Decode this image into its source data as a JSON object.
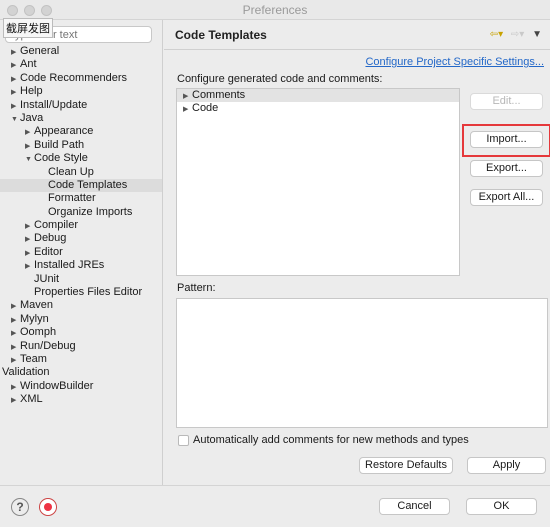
{
  "window": {
    "title": "Preferences",
    "capture_label": "截屏发图"
  },
  "sidebar": {
    "filter_placeholder": "type filter text",
    "items": [
      {
        "label": "General",
        "arrow": "▶"
      },
      {
        "label": "Ant",
        "arrow": "▶"
      },
      {
        "label": "Code Recommenders",
        "arrow": "▶"
      },
      {
        "label": "Help",
        "arrow": "▶"
      },
      {
        "label": "Install/Update",
        "arrow": "▶"
      },
      {
        "label": "Java",
        "arrow": "▼"
      },
      {
        "label": "Appearance",
        "arrow": "▶"
      },
      {
        "label": "Build Path",
        "arrow": "▶"
      },
      {
        "label": "Code Style",
        "arrow": "▼"
      },
      {
        "label": "Clean Up",
        "arrow": ""
      },
      {
        "label": "Code Templates",
        "arrow": ""
      },
      {
        "label": "Formatter",
        "arrow": ""
      },
      {
        "label": "Organize Imports",
        "arrow": ""
      },
      {
        "label": "Compiler",
        "arrow": "▶"
      },
      {
        "label": "Debug",
        "arrow": "▶"
      },
      {
        "label": "Editor",
        "arrow": "▶"
      },
      {
        "label": "Installed JREs",
        "arrow": "▶"
      },
      {
        "label": "JUnit",
        "arrow": ""
      },
      {
        "label": "Properties Files Editor",
        "arrow": ""
      },
      {
        "label": "Maven",
        "arrow": "▶"
      },
      {
        "label": "Mylyn",
        "arrow": "▶"
      },
      {
        "label": "Oomph",
        "arrow": "▶"
      },
      {
        "label": "Run/Debug",
        "arrow": "▶"
      },
      {
        "label": "Team",
        "arrow": "▶"
      },
      {
        "label": "Validation",
        "arrow": ""
      },
      {
        "label": "WindowBuilder",
        "arrow": "▶"
      },
      {
        "label": "XML",
        "arrow": "▶"
      }
    ]
  },
  "page": {
    "title": "Code Templates",
    "configure_link": "Configure Project Specific Settings...",
    "description": "Configure generated code and comments:",
    "templates": [
      {
        "label": "Comments",
        "arrow": "▶"
      },
      {
        "label": "Code",
        "arrow": "▶"
      }
    ],
    "buttons": {
      "edit": "Edit...",
      "import": "Import...",
      "export": "Export...",
      "export_all": "Export All..."
    },
    "pattern_label": "Pattern:",
    "auto_comment_label": "Automatically add comments for new methods and types",
    "restore_defaults": "Restore Defaults",
    "apply": "Apply"
  },
  "footer": {
    "cancel": "Cancel",
    "ok": "OK",
    "help_glyph": "?"
  },
  "icons": {
    "nav": [
      "back-arrow-icon",
      "dropdown-icon",
      "forward-arrow-icon",
      "dropdown-icon",
      "menu-icon"
    ]
  },
  "colors": {
    "link": "#2468c8",
    "highlight_box": "#e5383b"
  }
}
